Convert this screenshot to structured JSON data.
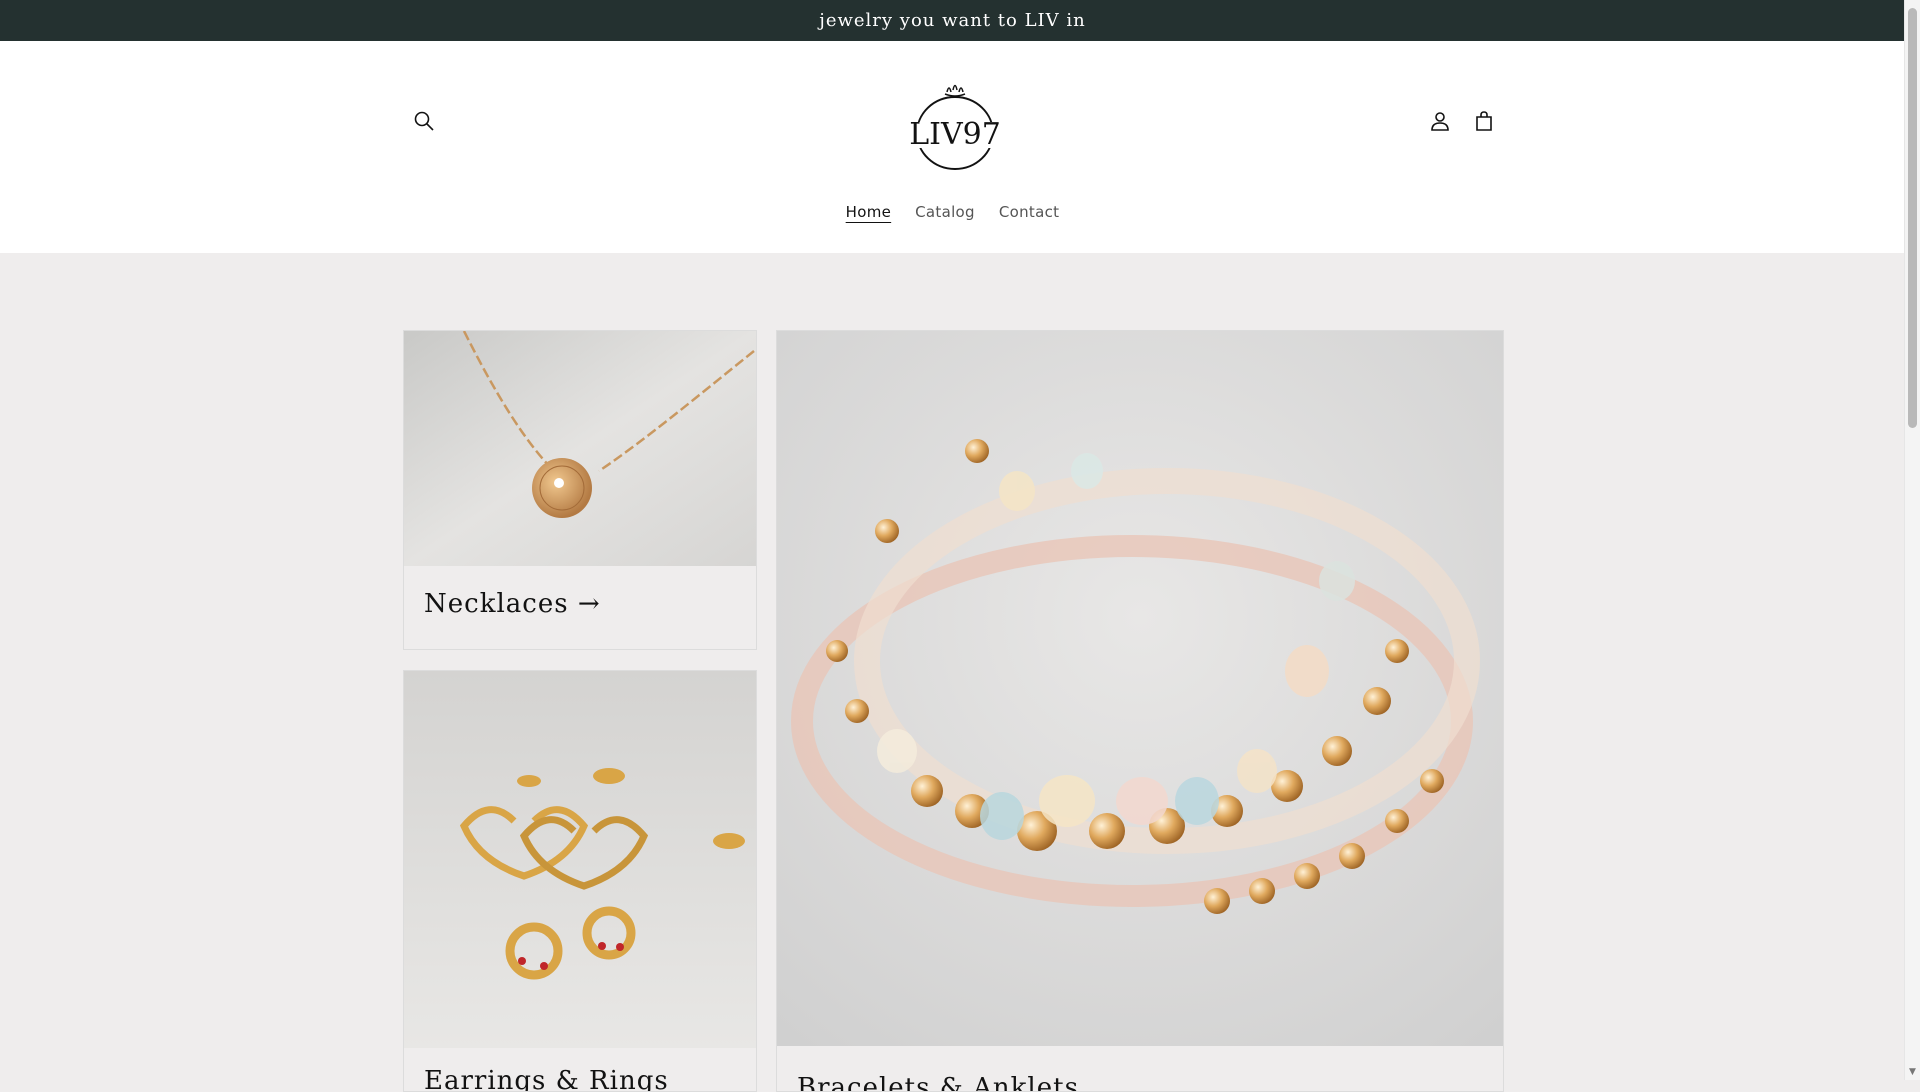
{
  "announcement": {
    "text": "jewelry you want to LIV in"
  },
  "header": {
    "logo_text": "LIV97",
    "search_icon": "search-icon",
    "account_icon": "account-icon",
    "cart_icon": "cart-icon"
  },
  "nav": {
    "items": [
      {
        "label": "Home",
        "active": true
      },
      {
        "label": "Catalog",
        "active": false
      },
      {
        "label": "Contact",
        "active": false
      }
    ]
  },
  "collections": [
    {
      "title": "Necklaces →",
      "image": "gold-necklace-medallion"
    },
    {
      "title": "Earrings & Rings",
      "image": "gold-heart-earrings"
    },
    {
      "title": "Bracelets & Anklets",
      "image": "beaded-bracelets"
    }
  ],
  "colors": {
    "announcement_bg": "#243130",
    "page_bg": "#efeded",
    "header_bg": "#ffffff"
  }
}
